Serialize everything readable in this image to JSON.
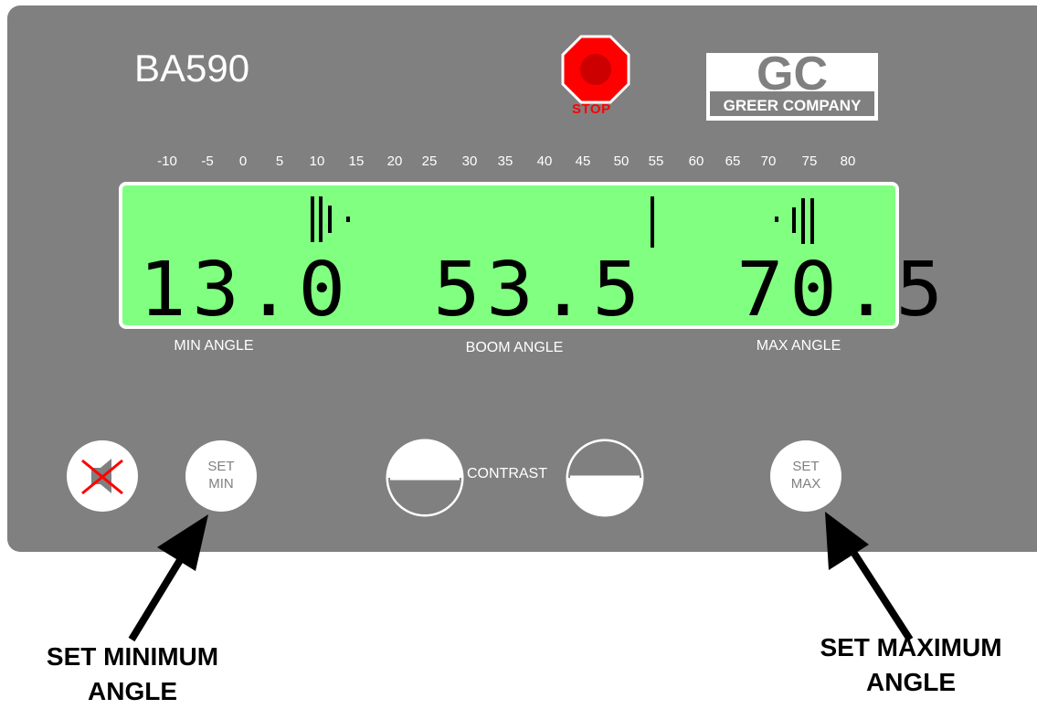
{
  "device": {
    "model": "BA590",
    "stop_label": "STOP",
    "brand_initials": "GC",
    "brand_name": "GREER COMPANY"
  },
  "scale": {
    "ticks": [
      "-10",
      "-5",
      "0",
      "5",
      "10",
      "15",
      "20",
      "25",
      "30",
      "35",
      "40",
      "45",
      "50",
      "55",
      "60",
      "65",
      "70",
      "75",
      "80"
    ]
  },
  "display": {
    "min_angle": "13.0",
    "boom_angle": "53.5",
    "max_angle": "70.5",
    "background_color": "#80ff80"
  },
  "labels": {
    "min_angle": "MIN ANGLE",
    "boom_angle": "BOOM ANGLE",
    "max_angle": "MAX ANGLE",
    "contrast": "CONTRAST"
  },
  "buttons": {
    "mute_icon": "speaker-muted-icon",
    "set_min_line1": "SET",
    "set_min_line2": "MIN",
    "set_max_line1": "SET",
    "set_max_line2": "MAX",
    "contrast_down_icon": "contrast-decrease-icon",
    "contrast_up_icon": "contrast-increase-icon"
  },
  "callouts": {
    "set_min_line1": "SET MINIMUM",
    "set_min_line2": "ANGLE",
    "set_max_line1": "SET MAXIMUM",
    "set_max_line2": "ANGLE"
  },
  "colors": {
    "panel": "#808080",
    "stop": "#ff0000",
    "lcd": "#80ff80"
  }
}
